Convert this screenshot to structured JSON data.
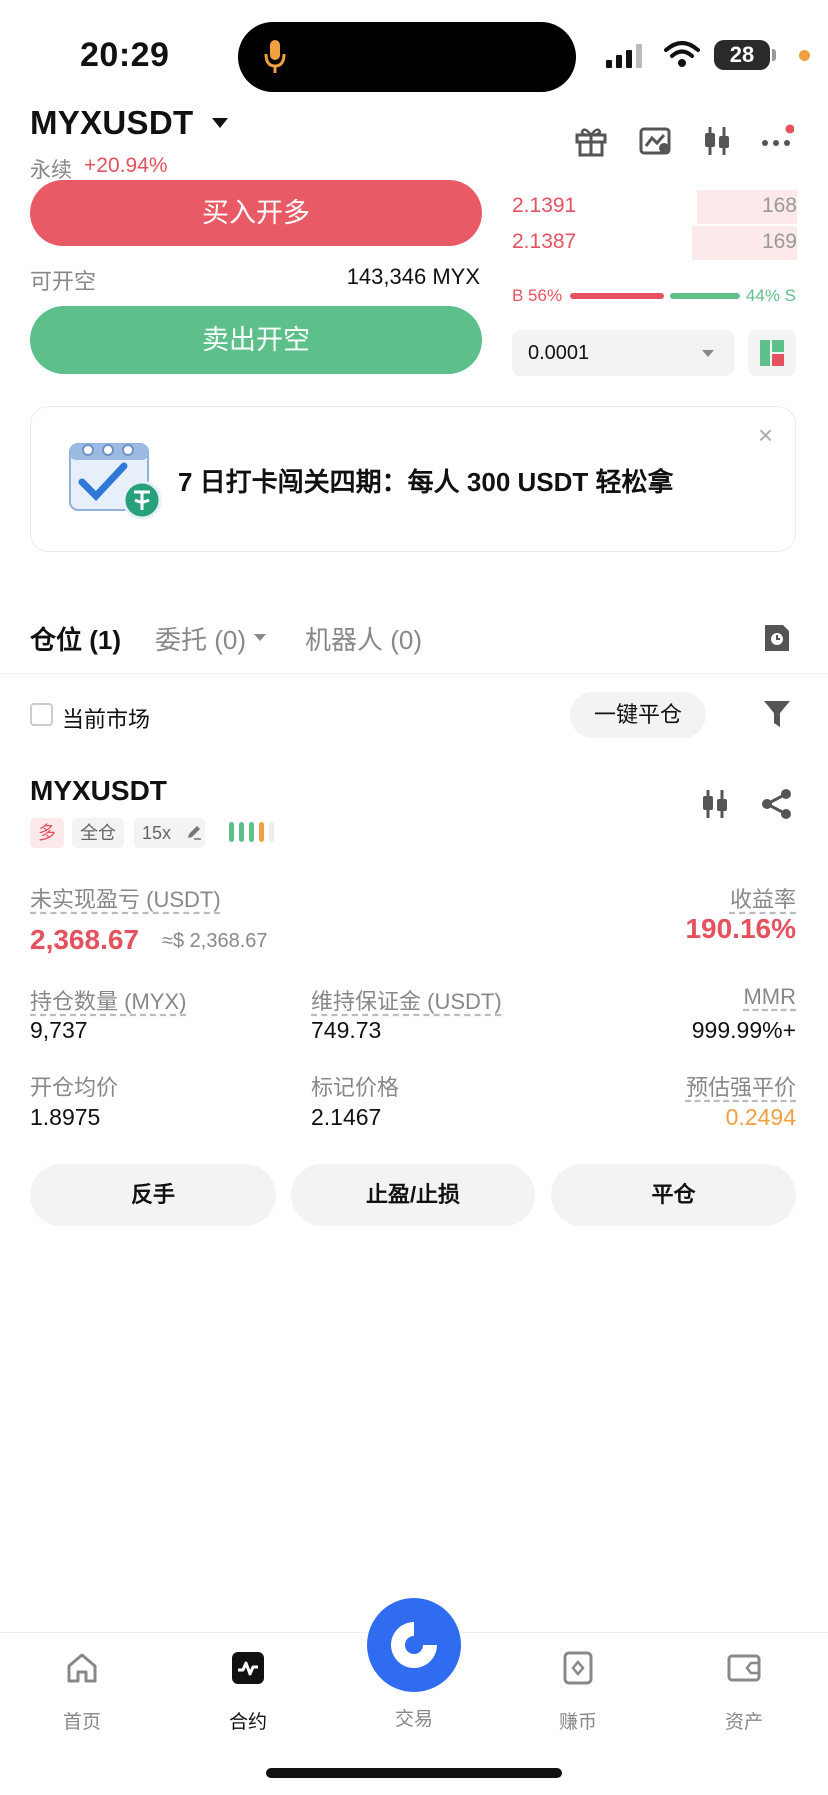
{
  "status_bar": {
    "time": "20:29",
    "battery": "28"
  },
  "header": {
    "symbol": "MYXUSDT",
    "contract_type": "永续",
    "change": "+20.94%"
  },
  "trade": {
    "buy_long_label": "买入开多",
    "sell_short_label": "卖出开空",
    "available_label": "可开空",
    "available_value": "143,346 MYX"
  },
  "orderbook": {
    "asks": [
      {
        "price": "2.1391",
        "qty": "168",
        "depth": 0.35
      },
      {
        "price": "2.1387",
        "qty": "169",
        "depth": 0.37
      }
    ],
    "buy_ratio_label": "B 56%",
    "sell_ratio_label": "44% S",
    "buy_ratio": 0.56,
    "precision": "0.0001"
  },
  "banner": {
    "text": "7 日打卡闯关四期：每人 300 USDT 轻松拿",
    "close": "×"
  },
  "tabs": {
    "positions": "仓位 (1)",
    "orders": "委托 (0)",
    "bots": "机器人 (0)"
  },
  "filters": {
    "current_market": "当前市场",
    "close_all": "一键平仓"
  },
  "position": {
    "symbol": "MYXUSDT",
    "side": "多",
    "margin_mode": "全仓",
    "leverage": "15x",
    "unrealized_pnl_label": "未实现盈亏 (USDT)",
    "unrealized_pnl": "2,368.67",
    "unrealized_pnl_usd": "≈$ 2,368.67",
    "roi_label": "收益率",
    "roi": "190.16%",
    "size_label": "持仓数量 (MYX)",
    "size": "9,737",
    "maint_margin_label": "维持保证金 (USDT)",
    "maint_margin": "749.73",
    "mmr_label": "MMR",
    "mmr": "999.99%+",
    "entry_label": "开仓均价",
    "entry": "1.8975",
    "mark_label": "标记价格",
    "mark": "2.1467",
    "liq_label": "预估强平价",
    "liq": "0.2494",
    "actions": {
      "reverse": "反手",
      "tpsl": "止盈/止损",
      "close": "平仓"
    }
  },
  "nav": {
    "items": [
      {
        "label": "首页",
        "icon": "home-icon"
      },
      {
        "label": "合约",
        "icon": "futures-icon"
      },
      {
        "label": "交易",
        "icon": "trade-icon"
      },
      {
        "label": "赚币",
        "icon": "earn-icon"
      },
      {
        "label": "资产",
        "icon": "assets-icon"
      }
    ]
  },
  "colors": {
    "red": "#e5525f",
    "green": "#5dbf8a",
    "orange": "#f0a040",
    "blue": "#2f6cf0"
  }
}
